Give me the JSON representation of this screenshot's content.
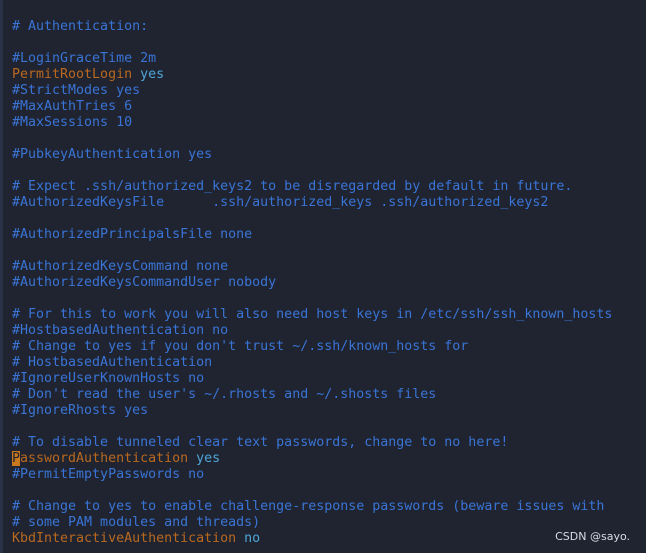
{
  "colors": {
    "background": "#1f2430",
    "comment": "#3a74d6",
    "keyword": "#b9681f",
    "value": "#4ea6d9",
    "cursor": "#c8781e"
  },
  "lines": [
    [
      [
        "# Authentication:",
        "c"
      ]
    ],
    [],
    [
      [
        "#LoginGraceTime 2m",
        "c"
      ]
    ],
    [
      [
        "PermitRootLogin",
        "k"
      ],
      [
        " yes",
        "v"
      ]
    ],
    [
      [
        "#StrictModes yes",
        "c"
      ]
    ],
    [
      [
        "#MaxAuthTries 6",
        "c"
      ]
    ],
    [
      [
        "#MaxSessions 10",
        "c"
      ]
    ],
    [],
    [
      [
        "#PubkeyAuthentication yes",
        "c"
      ]
    ],
    [],
    [
      [
        "# Expect .ssh/authorized_keys2 to be disregarded by default in future.",
        "c"
      ]
    ],
    [
      [
        "#AuthorizedKeysFile      .ssh/authorized_keys .ssh/authorized_keys2",
        "c"
      ]
    ],
    [],
    [
      [
        "#AuthorizedPrincipalsFile none",
        "c"
      ]
    ],
    [],
    [
      [
        "#AuthorizedKeysCommand none",
        "c"
      ]
    ],
    [
      [
        "#AuthorizedKeysCommandUser nobody",
        "c"
      ]
    ],
    [],
    [
      [
        "# For this to work you will also need host keys in /etc/ssh/ssh_known_hosts",
        "c"
      ]
    ],
    [
      [
        "#HostbasedAuthentication no",
        "c"
      ]
    ],
    [
      [
        "# Change to yes if you don't trust ~/.ssh/known_hosts for",
        "c"
      ]
    ],
    [
      [
        "# HostbasedAuthentication",
        "c"
      ]
    ],
    [
      [
        "#IgnoreUserKnownHosts no",
        "c"
      ]
    ],
    [
      [
        "# Don't read the user's ~/.rhosts and ~/.shosts files",
        "c"
      ]
    ],
    [
      [
        "#IgnoreRhosts yes",
        "c"
      ]
    ],
    [],
    [
      [
        "# To disable tunneled clear text passwords, change to no here!",
        "c"
      ]
    ],
    [
      [
        "P",
        "cur"
      ],
      [
        "asswordAuthentication",
        "k"
      ],
      [
        " yes",
        "v"
      ]
    ],
    [
      [
        "#PermitEmptyPasswords no",
        "c"
      ]
    ],
    [],
    [
      [
        "# Change to yes to enable challenge-response passwords (beware issues with",
        "c"
      ]
    ],
    [
      [
        "# some PAM modules and threads)",
        "c"
      ]
    ],
    [
      [
        "KbdInteractiveAuthentication",
        "k"
      ],
      [
        " no",
        "v"
      ]
    ]
  ],
  "watermark": "CSDN @sayo."
}
